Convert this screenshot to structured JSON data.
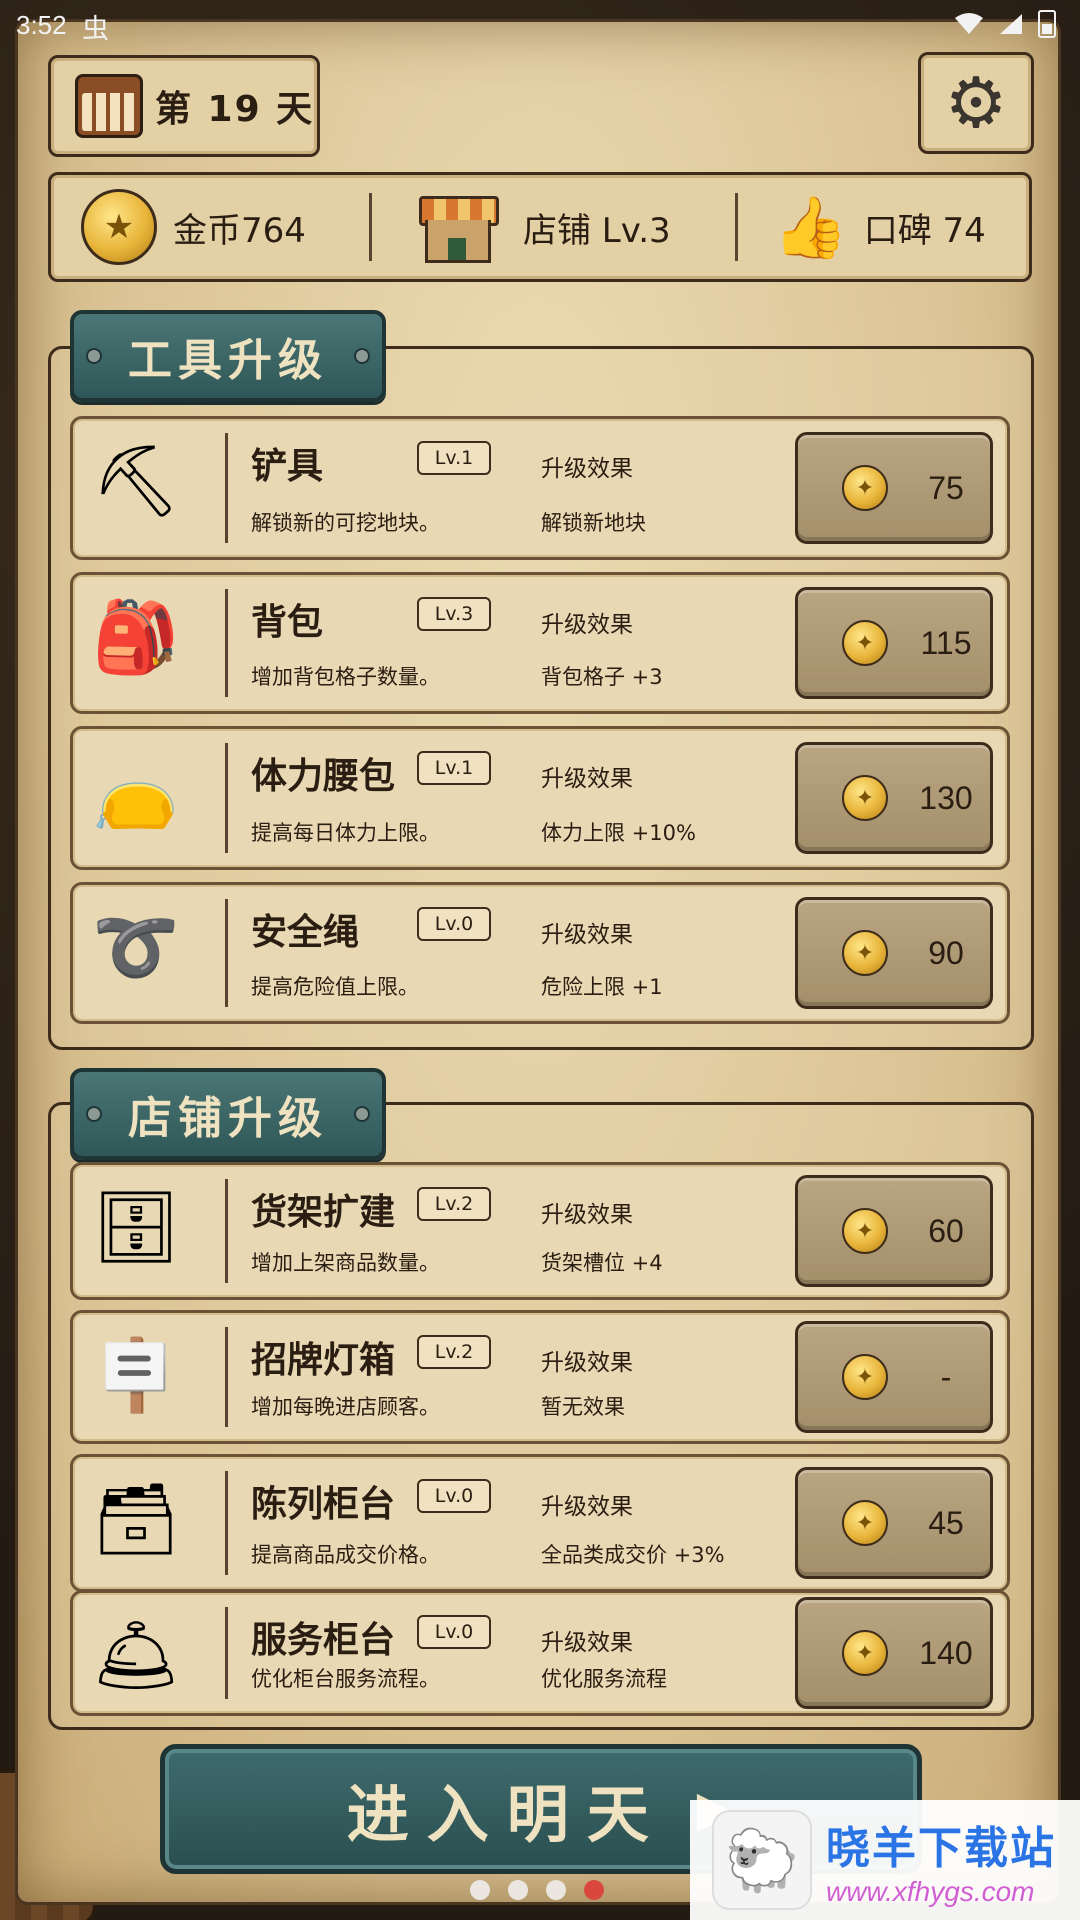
{
  "status_bar": {
    "time": "3:52",
    "bug_icon": "虫"
  },
  "header": {
    "day_label": "第 19 天"
  },
  "stats": {
    "gold": "金币764",
    "shop": "店铺 Lv.3",
    "reputation": "口碑 74"
  },
  "sections": {
    "tools": {
      "title": "工具升级",
      "items": [
        {
          "name": "铲具",
          "level": "Lv.1",
          "desc": "解锁新的可挖地块。",
          "effect_title": "升级效果",
          "effect_value": "解锁新地块",
          "cost": "75",
          "icon": "shovel-icon"
        },
        {
          "name": "背包",
          "level": "Lv.3",
          "desc": "增加背包格子数量。",
          "effect_title": "升级效果",
          "effect_value": "背包格子 +3",
          "cost": "115",
          "icon": "backpack-icon"
        },
        {
          "name": "体力腰包",
          "level": "Lv.1",
          "desc": "提高每日体力上限。",
          "effect_title": "升级效果",
          "effect_value": "体力上限 +10%",
          "cost": "130",
          "icon": "waist-pouch-icon"
        },
        {
          "name": "安全绳",
          "level": "Lv.0",
          "desc": "提高危险值上限。",
          "effect_title": "升级效果",
          "effect_value": "危险上限 +1",
          "cost": "90",
          "icon": "rope-icon"
        }
      ]
    },
    "shop": {
      "title": "店铺升级",
      "items": [
        {
          "name": "货架扩建",
          "level": "Lv.2",
          "desc": "增加上架商品数量。",
          "effect_title": "升级效果",
          "effect_value": "货架槽位 +4",
          "cost": "60",
          "icon": "shelf-icon"
        },
        {
          "name": "招牌灯箱",
          "level": "Lv.2",
          "desc": "增加每晚进店顾客。",
          "effect_title": "升级效果",
          "effect_value": "暂无效果",
          "cost": "-",
          "icon": "lightbox-sign-icon"
        },
        {
          "name": "陈列柜台",
          "level": "Lv.0",
          "desc": "提高商品成交价格。",
          "effect_title": "升级效果",
          "effect_value": "全品类成交价 +3%",
          "cost": "45",
          "icon": "display-cabinet-icon"
        },
        {
          "name": "服务柜台",
          "level": "Lv.0",
          "desc": "优化柜台服务流程。",
          "effect_title": "升级效果",
          "effect_value": "优化服务流程",
          "cost": "140",
          "icon": "service-counter-icon"
        }
      ]
    }
  },
  "next_day_button": {
    "label": "进入明天",
    "arrow": "▶"
  },
  "pagination": {
    "count": 4,
    "active_index": 3
  },
  "watermark": {
    "title": "晓羊下载站",
    "url": "www.xfhygs.com"
  },
  "colors": {
    "ribbon": "#3f6b6d",
    "parchment": "#dcc597",
    "active_dot": "#d9473f"
  }
}
